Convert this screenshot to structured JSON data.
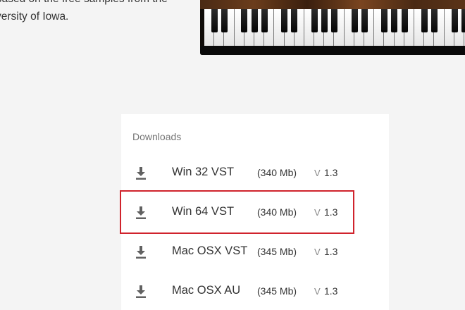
{
  "intro": {
    "line1": "based on the free samples from the",
    "line2": "versity of Iowa."
  },
  "downloads": {
    "title": "Downloads",
    "icon": "download-icon",
    "version_prefix": "V",
    "items": [
      {
        "name": "Win 32 VST",
        "size": "(340 Mb)",
        "version": "1.3"
      },
      {
        "name": "Win 64 VST",
        "size": "(340 Mb)",
        "version": "1.3",
        "highlighted": true
      },
      {
        "name": "Mac OSX VST",
        "size": "(345 Mb)",
        "version": "1.3"
      },
      {
        "name": "Mac OSX AU",
        "size": "(345 Mb)",
        "version": "1.3"
      }
    ]
  },
  "colors": {
    "page_bg": "#f4f4f4",
    "card_bg": "#ffffff",
    "highlight_border": "#d0232c",
    "text": "#333333",
    "muted": "#757575"
  }
}
